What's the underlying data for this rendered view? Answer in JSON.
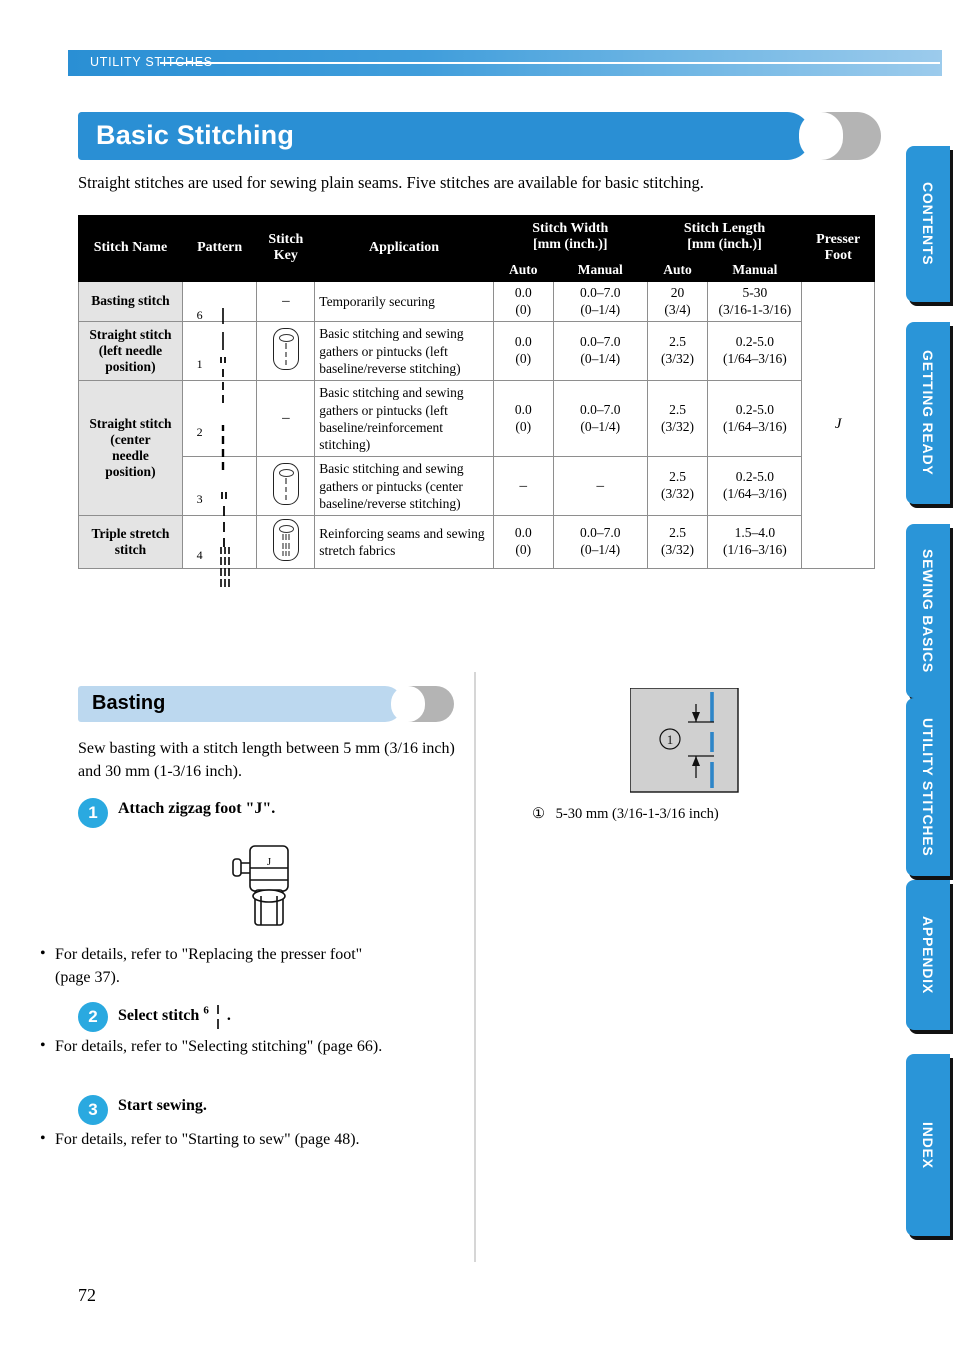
{
  "running_header": {
    "label": "UTILITY STITCHES"
  },
  "chapter": {
    "title": "Basic Stitching"
  },
  "intro": "Straight stitches are used for sewing plain seams. Five stitches are available for basic stitching.",
  "table": {
    "headers": {
      "stitch_name": "Stitch Name",
      "pattern": "Pattern",
      "stitch_key": "Stitch Key",
      "application": "Application",
      "stitch_width": "Stitch Width [mm (inch.)]",
      "stitch_width_l1": "Stitch Width",
      "stitch_width_l2": "[mm (inch.)]",
      "stitch_length": "Stitch Length [mm (inch.)]",
      "stitch_length_l1": "Stitch Length",
      "stitch_length_l2": "[mm (inch.)]",
      "presser_foot": "Presser Foot",
      "presser_foot_l1": "Presser",
      "presser_foot_l2": "Foot",
      "auto": "Auto",
      "manual": "Manual"
    },
    "presser_foot_value": "J",
    "rows": [
      {
        "name": "Basting stitch",
        "pattern_number": "6",
        "stitch_key": "–",
        "has_key_icon": false,
        "application": "Temporarily securing",
        "width_auto_1": "0.0",
        "width_auto_2": "(0)",
        "width_manual_1": "0.0–7.0",
        "width_manual_2": "(0–1/4)",
        "length_auto_1": "20",
        "length_auto_2": "(3/4)",
        "length_manual_1": "5-30",
        "length_manual_2": "(3/16-1-3/16)"
      },
      {
        "name": "Straight stitch (left needle position)",
        "name_l1": "Straight stitch",
        "name_l2": "(left needle",
        "name_l3": "position)",
        "pattern_number": "1",
        "stitch_key": "",
        "has_key_icon": true,
        "application": "Basic stitching and sewing gathers or pintucks (left baseline/reverse stitching)",
        "width_auto_1": "0.0",
        "width_auto_2": "(0)",
        "width_manual_1": "0.0–7.0",
        "width_manual_2": "(0–1/4)",
        "length_auto_1": "2.5",
        "length_auto_2": "(3/32)",
        "length_manual_1": "0.2-5.0",
        "length_manual_2": "(1/64–3/16)"
      },
      {
        "name": "Straight stitch (center needle position)",
        "name_l1": "Straight stitch",
        "name_l2": "(center",
        "name_l3": "needle",
        "name_l4": "position)",
        "pattern_number": "2",
        "stitch_key": "–",
        "has_key_icon": false,
        "application": "Basic stitching and sewing gathers or pintucks (left baseline/reinforcement stitching)",
        "width_auto_1": "0.0",
        "width_auto_2": "(0)",
        "width_manual_1": "0.0–7.0",
        "width_manual_2": "(0–1/4)",
        "length_auto_1": "2.5",
        "length_auto_2": "(3/32)",
        "length_manual_1": "0.2-5.0",
        "length_manual_2": "(1/64–3/16)"
      },
      {
        "name": "",
        "pattern_number": "3",
        "stitch_key": "",
        "has_key_icon": true,
        "application": "Basic stitching and sewing gathers or pintucks (center baseline/reverse stitching)",
        "width_auto_1": "–",
        "width_auto_2": "",
        "width_manual_1": "–",
        "width_manual_2": "",
        "length_auto_1": "2.5",
        "length_auto_2": "(3/32)",
        "length_manual_1": "0.2-5.0",
        "length_manual_2": "(1/64–3/16)"
      },
      {
        "name": "Triple stretch stitch",
        "name_l1": "Triple stretch",
        "name_l2": "stitch",
        "pattern_number": "4",
        "stitch_key": "",
        "has_key_icon": true,
        "application": "Reinforcing seams and sewing stretch fabrics",
        "width_auto_1": "0.0",
        "width_auto_2": "(0)",
        "width_manual_1": "0.0–7.0",
        "width_manual_2": "(0–1/4)",
        "length_auto_1": "2.5",
        "length_auto_2": "(3/32)",
        "length_manual_1": "1.5–4.0",
        "length_manual_2": "(1/16–3/16)"
      }
    ]
  },
  "section": {
    "title": "Basting",
    "lead": "Sew basting with a stitch length between 5 mm (3/16 inch) and 30 mm (1-3/16 inch).",
    "steps": [
      {
        "number": "1",
        "title": "Attach zigzag foot \"J\".",
        "bullet": "For details, refer to \"Replacing the presser foot\" (page 37)."
      },
      {
        "number": "2",
        "title_pre": "Select stitch",
        "title_sup": "6",
        "title_post": ".",
        "bullet": "For details, refer to \"Selecting stitching\" (page 66)."
      },
      {
        "number": "3",
        "title": "Start sewing.",
        "bullet": "For details, refer to \"Starting to sew\" (page 48)."
      }
    ]
  },
  "figure": {
    "caption_number": "①",
    "caption_text": "5-30 mm (3/16-1-3/16 inch)",
    "callout_label": "①",
    "foot_label": "J"
  },
  "side_tabs": [
    {
      "label": "CONTENTS"
    },
    {
      "label": "GETTING READY"
    },
    {
      "label": "SEWING BASICS"
    },
    {
      "label": "UTILITY STITCHES"
    },
    {
      "label": "APPENDIX"
    },
    {
      "label": "INDEX"
    }
  ],
  "page_number": "72",
  "colors": {
    "header_blue": "#2a8fd4",
    "tab_blue": "#2a95d8",
    "step_circle": "#2aa9e0",
    "section_bar": "#bcd8ef",
    "crescent_gray": "#b4b4b4",
    "fabric_gray": "#d0d0d0",
    "stitch_blue": "#2e86c8"
  }
}
